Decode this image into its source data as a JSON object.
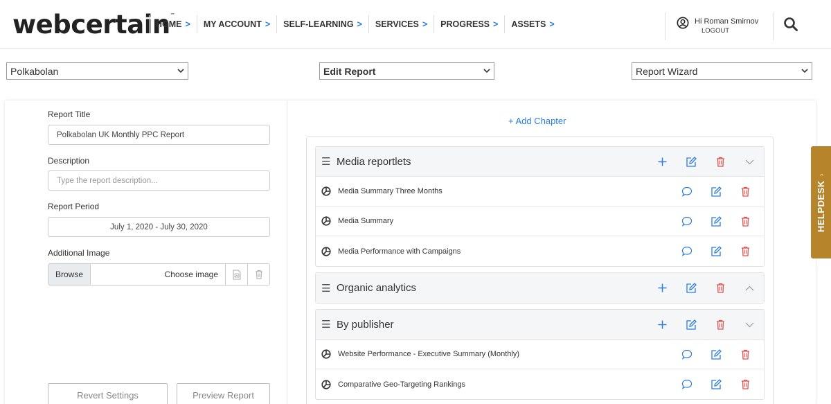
{
  "header": {
    "logo": "webcertain",
    "logo_tm": "™",
    "nav": [
      {
        "label": "HOME"
      },
      {
        "label": "MY ACCOUNT"
      },
      {
        "label": "SELF-LEARNING"
      },
      {
        "label": "SERVICES"
      },
      {
        "label": "PROGRESS"
      },
      {
        "label": "ASSETS"
      }
    ],
    "nav_chevron": ">",
    "user_greeting": "Hi Roman Smirnov",
    "logout": "LOGOUT"
  },
  "selectors": {
    "client": "Polkabolan",
    "action": "Edit Report",
    "mode": "Report Wizard"
  },
  "form": {
    "title_label": "Report Title",
    "title_value": "Polkabolan UK Monthly PPC Report",
    "description_label": "Description",
    "description_placeholder": "Type the report description...",
    "period_label": "Report Period",
    "period_value": "July 1, 2020 - July 30, 2020",
    "image_label": "Additional Image",
    "browse": "Browse",
    "choose_image": "Choose image",
    "revert": "Revert Settings",
    "preview": "Preview Report"
  },
  "add_chapter": "+ Add Chapter",
  "chapters": [
    {
      "title": "Media reportlets",
      "expanded": true,
      "items": [
        "Media Summary Three Months",
        "Media Summary",
        "Media Performance with Campaigns"
      ]
    },
    {
      "title": "Organic analytics",
      "expanded": false,
      "items": []
    },
    {
      "title": "By publisher",
      "expanded": true,
      "items": [
        "Website Performance - Executive Summary (Monthly)",
        "Comparative Geo-Targeting Rankings"
      ]
    }
  ],
  "helpdesk": "HELPDESK",
  "colors": {
    "accent": "#2a7de1",
    "danger": "#d9534f",
    "helpdesk": "#b6842a"
  }
}
